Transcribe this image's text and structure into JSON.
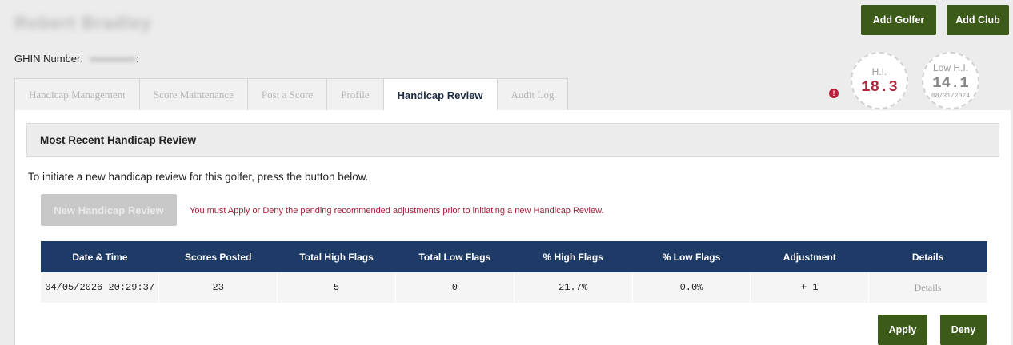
{
  "golfer": {
    "name": "Robert Bradley",
    "ghin_label": "GHIN Number:",
    "ghin_suffix": ":"
  },
  "header_buttons": {
    "add_golfer": "Add Golfer",
    "add_club": "Add Club"
  },
  "tabs": [
    {
      "label": "Handicap Management",
      "active": false
    },
    {
      "label": "Score Maintenance",
      "active": false
    },
    {
      "label": "Post a Score",
      "active": false
    },
    {
      "label": "Profile",
      "active": false
    },
    {
      "label": "Handicap Review",
      "active": true
    },
    {
      "label": "Audit Log",
      "active": false
    }
  ],
  "alert_icon": "!",
  "handicap": {
    "hi_label": "H.I.",
    "hi_value": "18.3",
    "low_label": "Low H.I.",
    "low_value": "14.1",
    "low_date": "08/31/2024"
  },
  "review": {
    "title": "Most Recent Handicap Review",
    "instructions": "To initiate a new handicap review for this golfer, press the button below.",
    "new_button": "New Handicap Review",
    "warning": "You must Apply or Deny the pending recommended adjustments prior to initiating a new Handicap Review.",
    "columns": [
      "Date & Time",
      "Scores Posted",
      "Total High Flags",
      "Total Low Flags",
      "% High Flags",
      "% Low Flags",
      "Adjustment",
      "Details"
    ],
    "rows": [
      [
        "04/05/2026 20:29:37",
        "23",
        "5",
        "0",
        "21.7%",
        "0.0%",
        "+ 1",
        "Details"
      ]
    ],
    "apply": "Apply",
    "deny": "Deny"
  },
  "colors": {
    "primary_green": "#3c5a18",
    "table_header": "#1e3a66",
    "alert_red": "#b9203a"
  }
}
